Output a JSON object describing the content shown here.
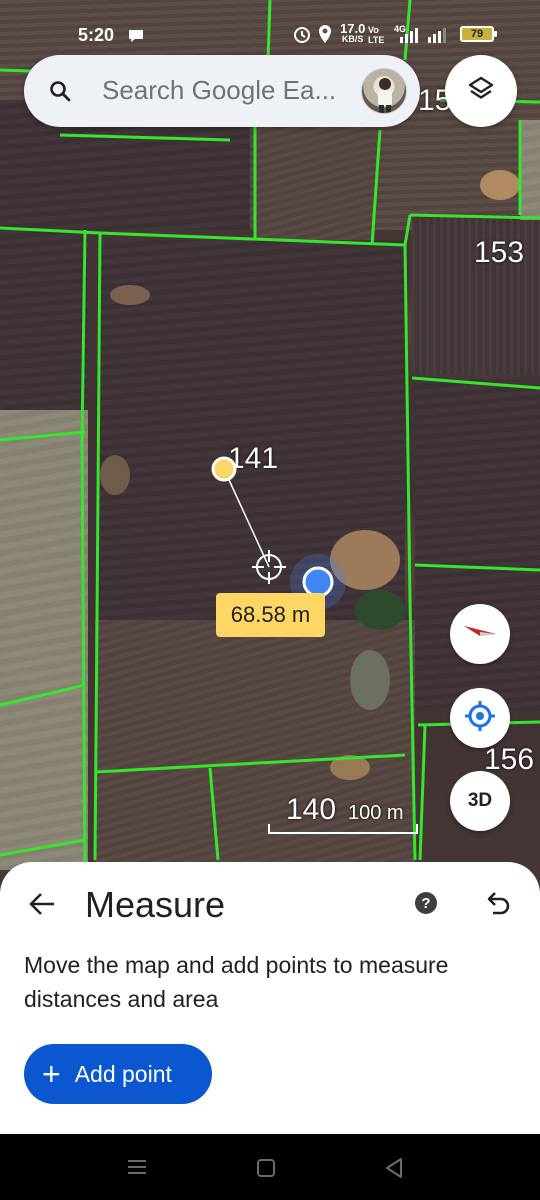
{
  "status_bar": {
    "time": "5:20",
    "net_speed": "17.0",
    "net_speed_unit": "KB/S",
    "volte": "Vo LTE",
    "network": "4G",
    "battery": "79"
  },
  "search": {
    "placeholder": "Search Google Ea..."
  },
  "map": {
    "parcel_labels": [
      "15",
      "153",
      "141",
      "156",
      "140"
    ]
  },
  "measure": {
    "distance": "68.58 m"
  },
  "controls": {
    "threed_label": "3D",
    "scale_label": "100 m"
  },
  "sheet": {
    "title": "Measure",
    "description": "Move the map and add points to measure distances and area",
    "add_point_label": "Add point"
  },
  "colors": {
    "parcel_boundary": "#35e62c",
    "distance_label_bg": "#fdd663",
    "accent": "#0b57d0",
    "location_dot": "#4285f4"
  }
}
